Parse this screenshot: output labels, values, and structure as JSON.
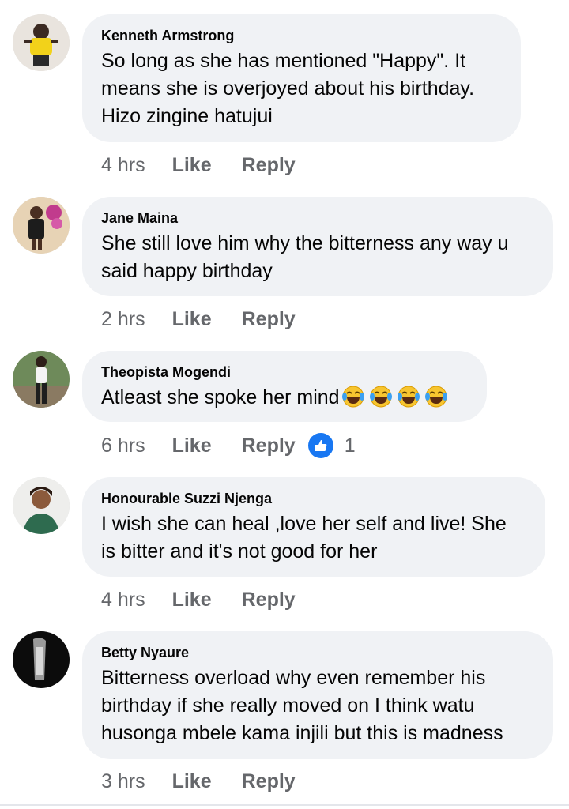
{
  "comments": [
    {
      "author": "Kenneth Armstrong",
      "text": "So long as she has mentioned \"Happy\". It\nmeans she is overjoyed about his birthday.\nHizo zingine hatujui",
      "time": "4 hrs",
      "like_label": "Like",
      "reply_label": "Reply",
      "avatar_icon": "profile-photo-child-yellow-shirt"
    },
    {
      "author": "Jane Maina",
      "text": "She still love him why the bitterness any way u\nsaid happy birthday",
      "time": "2 hrs",
      "like_label": "Like",
      "reply_label": "Reply",
      "avatar_icon": "profile-photo-woman-flowers"
    },
    {
      "author": "Theopista Mogendi",
      "text": "Atleast she spoke her mind",
      "emoji": "tears-of-joy-icon",
      "emoji_count": 4,
      "time": "6 hrs",
      "like_label": "Like",
      "reply_label": "Reply",
      "reaction_icon": "thumbs-up-icon",
      "reaction_count": "1",
      "avatar_icon": "profile-photo-woman-standing"
    },
    {
      "author": "Honourable Suzzi Njenga",
      "text": "I wish she can heal ,love her self and live! She\nis bitter and it's not good for her",
      "time": "4 hrs",
      "like_label": "Like",
      "reply_label": "Reply",
      "avatar_icon": "profile-photo-woman-portrait"
    },
    {
      "author": "Betty Nyaure",
      "text": "Bitterness overload why even remember his\nbirthday if she really moved on I think watu\nhusonga mbele kama injili but this is madness",
      "time": "3 hrs",
      "like_label": "Like",
      "reply_label": "Reply",
      "avatar_icon": "profile-photo-dark"
    }
  ],
  "colors": {
    "bubble": "#f0f2f5",
    "meta_text": "#65676b",
    "like_blue": "#1877f2"
  }
}
